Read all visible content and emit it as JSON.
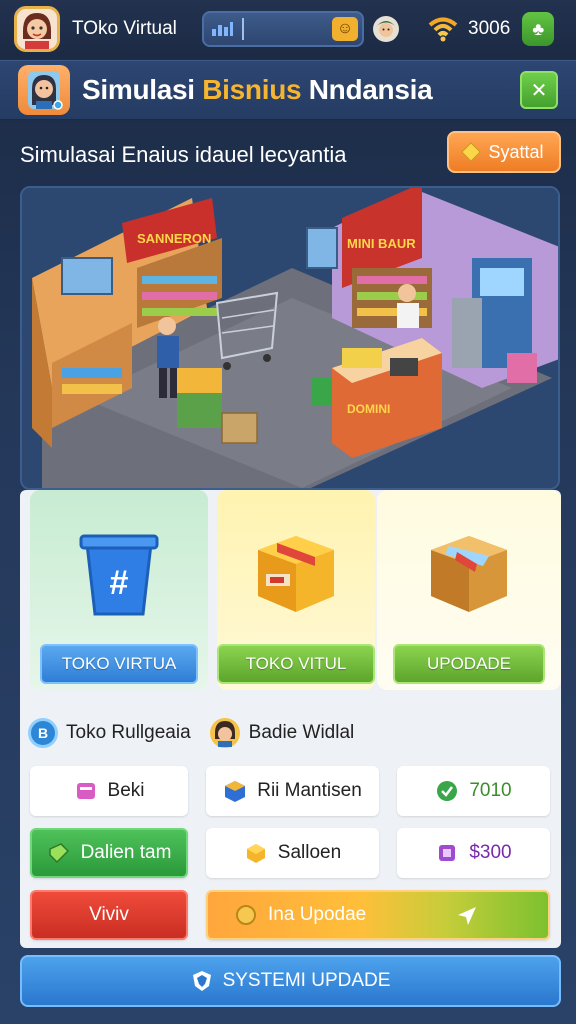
{
  "topbar": {
    "title": "TOko Virtual",
    "coins": "3006"
  },
  "header": {
    "title_part1": "Simulasi ",
    "title_highlight": "Bisnius",
    "title_part2": " Nndansia"
  },
  "subtitle": "Simulasai Enaius idauel lecyantia",
  "start_button": "Syattal",
  "cards": [
    {
      "button": "TOKO VIRTUA"
    },
    {
      "button": "TOKO VITUL"
    },
    {
      "button": "UPODADE"
    }
  ],
  "info": [
    {
      "badge": "B",
      "label": "Toko Rullgeaia"
    },
    {
      "label": "Badie Widlal"
    }
  ],
  "tiles": {
    "beli": "Beki",
    "rii": "Rii Mantisen",
    "price1": "7010",
    "dalien": "Dalien tam",
    "salloen": "Salloen",
    "price2": "$300",
    "vivi": "Viviv",
    "upgrade": "Ina Upodae"
  },
  "bottom_button": "SYSTEMI UPDADE",
  "colors": {
    "accent_orange": "#ef7d25",
    "accent_green": "#5da52c",
    "accent_blue": "#2f7ed6",
    "highlight_yellow": "#f6b531"
  }
}
